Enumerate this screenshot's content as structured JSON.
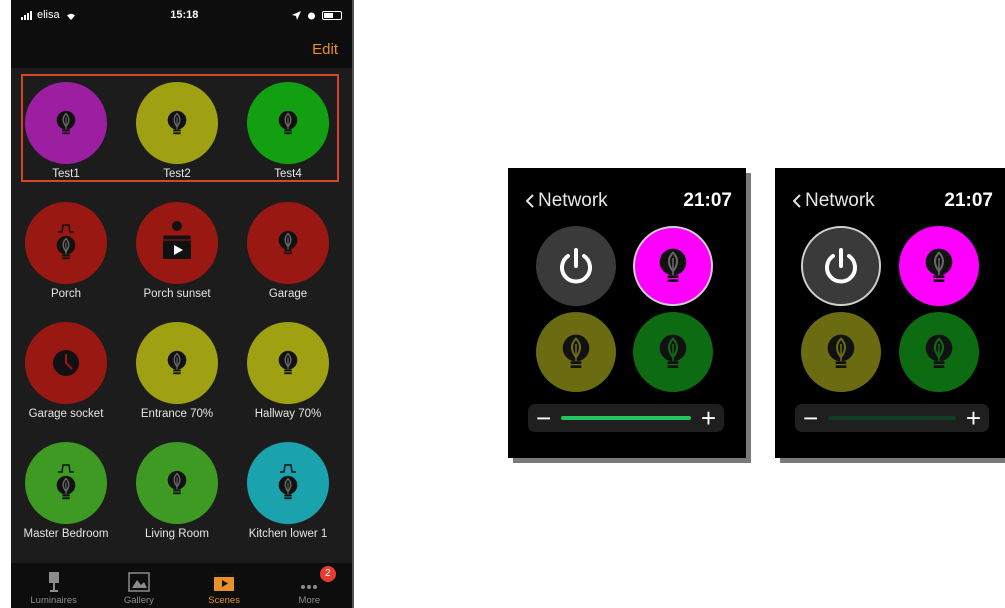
{
  "phone": {
    "status": {
      "carrier": "elisa",
      "time": "15:18"
    },
    "nav": {
      "edit_label": "Edit"
    },
    "scenes": [
      {
        "label": "Test1",
        "color": "#9b1fa0",
        "icon": "bulb-icon"
      },
      {
        "label": "Test2",
        "color": "#a0a013",
        "icon": "bulb-icon"
      },
      {
        "label": "Test4",
        "color": "#12a012",
        "icon": "bulb-icon"
      },
      {
        "label": "Porch",
        "color": "#9a1812",
        "icon": "bulb-timer-icon"
      },
      {
        "label": "Porch sunset",
        "color": "#9a1812",
        "icon": "scene-film-icon"
      },
      {
        "label": "Garage",
        "color": "#9a1812",
        "icon": "bulb-icon"
      },
      {
        "label": "Garage socket",
        "color": "#9a1812",
        "icon": "clock-icon"
      },
      {
        "label": "Entrance 70%",
        "color": "#a0a013",
        "icon": "bulb-icon"
      },
      {
        "label": "Hallway 70%",
        "color": "#a0a013",
        "icon": "bulb-icon"
      },
      {
        "label": "Master Bedroom",
        "color": "#3f9a24",
        "icon": "bulb-timer-icon"
      },
      {
        "label": "Living Room",
        "color": "#3f9a24",
        "icon": "bulb-icon"
      },
      {
        "label": "Kitchen lower 1",
        "color": "#1aa3ad",
        "icon": "bulb-timer-icon"
      }
    ],
    "tabs": [
      {
        "label": "Luminaires",
        "icon": "lamp-icon",
        "active": false
      },
      {
        "label": "Gallery",
        "icon": "gallery-icon",
        "active": false
      },
      {
        "label": "Scenes",
        "icon": "scenes-icon",
        "active": true
      },
      {
        "label": "More",
        "icon": "more-icon",
        "active": false,
        "badge": "2"
      }
    ]
  },
  "watches": [
    {
      "back_label": "Network",
      "time": "21:07",
      "power_color": "#3a3a3a",
      "buttons": [
        "#ff00ff",
        "#6b6b12",
        "#0d6b12"
      ],
      "slider_color": "#22c55e",
      "minus": "−",
      "plus": "+"
    },
    {
      "back_label": "Network",
      "time": "21:07",
      "power_color": "#3a3a3a",
      "buttons": [
        "#ff00ff",
        "#6b6b12",
        "#0d6b12"
      ],
      "slider_color": "#0f3d1f",
      "minus": "−",
      "plus": "+"
    }
  ]
}
